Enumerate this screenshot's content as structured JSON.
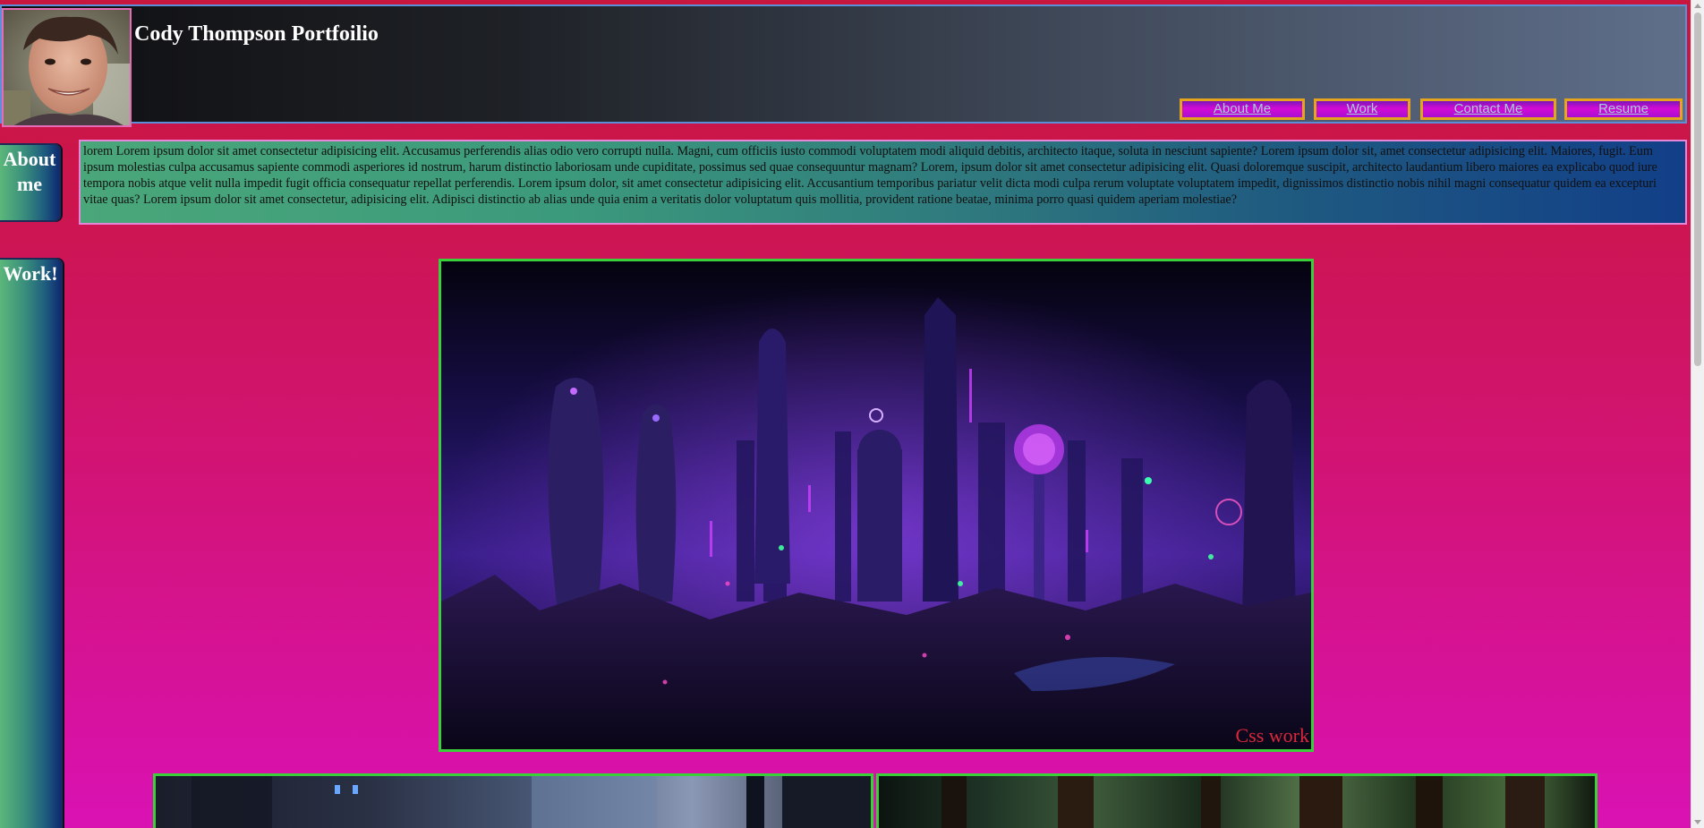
{
  "header": {
    "title": "Cody Thompson Portfoilio",
    "nav": [
      {
        "label": "About Me"
      },
      {
        "label": "Work"
      },
      {
        "label": "Contact Me"
      },
      {
        "label": "Resume"
      }
    ]
  },
  "about": {
    "label": "About me",
    "text": "lorem Lorem ipsum dolor sit amet consectetur adipisicing elit. Accusamus perferendis alias odio vero corrupti nulla. Magni, cum officiis iusto commodi voluptatem modi aliquid debitis, architecto itaque, soluta in nesciunt sapiente? Lorem ipsum dolor sit, amet consectetur adipisicing elit. Maiores, fugit. Eum ipsum molestias culpa accusamus sapiente commodi asperiores id nostrum, harum distinctio laboriosam unde cupiditate, possimus sed quae consequuntur magnam? Lorem, ipsum dolor sit amet consectetur adipisicing elit. Quasi doloremque suscipit, architecto laudantium libero maiores ea explicabo quod iure tempora nobis atque velit nulla impedit fugit officia consequatur repellat perferendis. Lorem ipsum dolor, sit amet consectetur adipisicing elit. Accusantium temporibus pariatur velit dicta modi culpa rerum voluptate voluptatem impedit, dignissimos distinctio nobis nihil magni consequatur quidem ea excepturi vitae quas? Lorem ipsum dolor sit amet consectetur, adipisicing elit. Adipisci distinctio ab alias unde quia enim a veritatis dolor voluptatum quis mollitia, provident ratione beatae, minima porro quasi quidem aperiam molestiae?"
  },
  "work": {
    "label": "Work!",
    "main_caption": "Css work"
  },
  "colors": {
    "page_top": "#c8163c",
    "page_bottom": "#d912b3",
    "nav_border": "#e5a41e",
    "work_border": "#3ad03a",
    "caption": "#d8283c"
  },
  "icons": {
    "avatar": "avatar-photo",
    "main_image": "neon-city-image",
    "thumb_a": "cyberpunk-street-image",
    "thumb_b": "forest-image"
  }
}
